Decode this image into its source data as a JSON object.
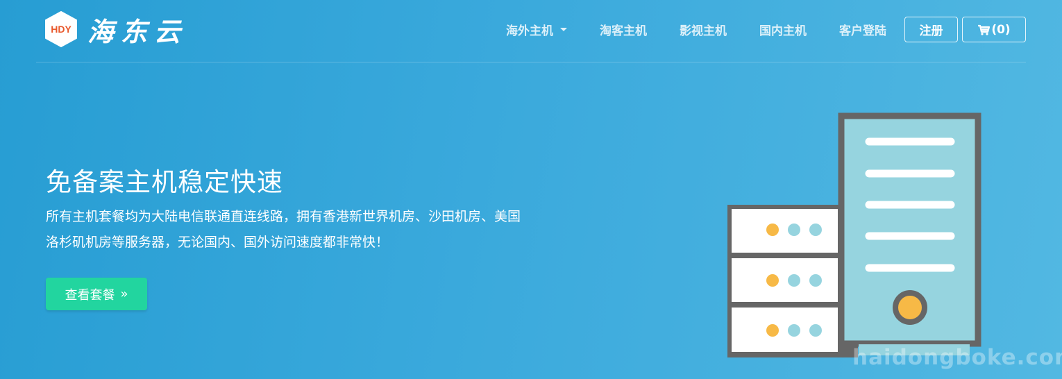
{
  "brand": {
    "logo_abbr": "HDY",
    "name": "海东云"
  },
  "nav": {
    "items": [
      {
        "label": "海外主机",
        "has_dropdown": true
      },
      {
        "label": "淘客主机"
      },
      {
        "label": "影视主机"
      },
      {
        "label": "国内主机"
      },
      {
        "label": "客户登陆"
      }
    ],
    "register_label": "注册",
    "cart_label": "(0)",
    "cart_icon": "cart-icon"
  },
  "hero": {
    "title": "免备案主机稳定快速",
    "description": "所有主机套餐均为大陆电信联通直连线路，拥有香港新世界机房、沙田机房、美国洛杉矶机房等服务器，无论国内、国外访问速度都非常快！",
    "cta_label": "查看套餐",
    "cta_icon": "double-chevron-right-icon"
  },
  "illustration": {
    "icon": "server-rack-illustration",
    "colors": {
      "frame": "#666666",
      "panel": "#96d4df",
      "drawer": "#ffffff",
      "dot_yellow": "#f7b946",
      "dot_blue": "#96d4df"
    }
  },
  "watermark": "haidongboke.com",
  "colors": {
    "accent": "#22d59f",
    "logo_orange": "#e9582b",
    "background_start": "#279dd3",
    "background_end": "#52b8e2"
  }
}
